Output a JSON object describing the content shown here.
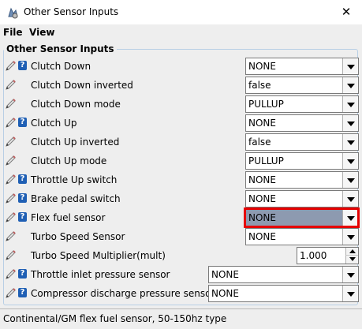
{
  "window": {
    "title": "Other Sensor Inputs",
    "close": "✕"
  },
  "menu": {
    "items": [
      "File",
      "View"
    ]
  },
  "group": {
    "title": "Other Sensor Inputs"
  },
  "rows": [
    {
      "label": "Clutch Down",
      "value": "NONE",
      "help": true
    },
    {
      "label": "Clutch Down inverted",
      "value": "false",
      "help": false
    },
    {
      "label": "Clutch Down mode",
      "value": "PULLUP",
      "help": false
    },
    {
      "label": "Clutch Up",
      "value": "NONE",
      "help": true
    },
    {
      "label": "Clutch Up inverted",
      "value": "false",
      "help": false
    },
    {
      "label": "Clutch Up mode",
      "value": "PULLUP",
      "help": false
    },
    {
      "label": "Throttle Up switch",
      "value": "NONE",
      "help": true
    },
    {
      "label": "Brake pedal switch",
      "value": "NONE",
      "help": true
    },
    {
      "label": "Flex fuel sensor",
      "value": "NONE",
      "help": true,
      "selected": true
    },
    {
      "label": "Turbo Speed Sensor",
      "value": "NONE",
      "help": false
    },
    {
      "label": "Turbo Speed Multiplier(mult)",
      "value": "1.000",
      "help": false,
      "spinner": true
    },
    {
      "label": "Throttle inlet pressure sensor",
      "value": "NONE",
      "help": true,
      "wide": true
    },
    {
      "label": "Compressor discharge pressure sensor",
      "value": "NONE",
      "help": true,
      "wide": true
    }
  ],
  "help_glyph": "?",
  "status": {
    "text": "Continental/GM flex fuel sensor, 50-150hz type"
  },
  "colors": {
    "selected_combo": "#8d9ab0",
    "highlight_border": "#e60000",
    "help_icon": "#1f5fb4"
  }
}
